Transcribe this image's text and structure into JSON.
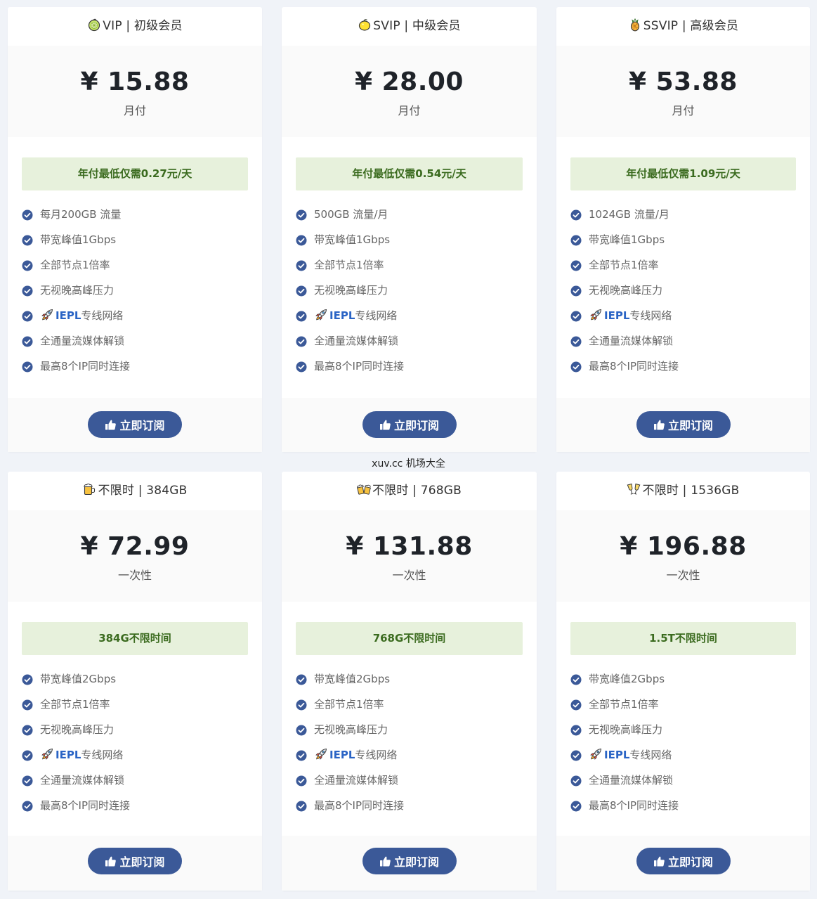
{
  "plans_row_1": [
    {
      "icon": "lime-icon",
      "title": "VIP | 初级会员",
      "price": "¥ 15.88",
      "period": "月付",
      "highlight": "年付最低仅需0.27元/天",
      "features": [
        "每月200GB 流量",
        "带宽峰值1Gbps",
        "全部节点1倍率",
        "无视晚高峰压力",
        "IEPL|专线网络",
        "全通量流媒体解锁",
        "最高8个IP同时连接"
      ],
      "button": "立即订阅"
    },
    {
      "icon": "lemon-icon",
      "title": "SVIP | 中级会员",
      "price": "¥ 28.00",
      "period": "月付",
      "highlight": "年付最低仅需0.54元/天",
      "features": [
        "500GB 流量/月",
        "带宽峰值1Gbps",
        "全部节点1倍率",
        "无视晚高峰压力",
        "IEPL|专线网络",
        "全通量流媒体解锁",
        "最高8个IP同时连接"
      ],
      "button": "立即订阅"
    },
    {
      "icon": "pineapple-icon",
      "title": "SSVIP | 高级会员",
      "price": "¥ 53.88",
      "period": "月付",
      "highlight": "年付最低仅需1.09元/天",
      "features": [
        "1024GB 流量/月",
        "带宽峰值1Gbps",
        "全部节点1倍率",
        "无视晚高峰压力",
        "IEPL|专线网络",
        "全通量流媒体解锁",
        "最高8个IP同时连接"
      ],
      "button": "立即订阅"
    }
  ],
  "watermark": "xuv.cc 机场大全",
  "plans_row_2": [
    {
      "icon": "beer-mug-icon",
      "title": "不限时 | 384GB",
      "price": "¥ 72.99",
      "period": "一次性",
      "highlight": "384G不限时间",
      "features": [
        "带宽峰值2Gbps",
        "全部节点1倍率",
        "无视晚高峰压力",
        "IEPL|专线网络",
        "全通量流媒体解锁",
        "最高8个IP同时连接"
      ],
      "button": "立即订阅"
    },
    {
      "icon": "clinking-beers-icon",
      "title": "不限时 | 768GB",
      "price": "¥ 131.88",
      "period": "一次性",
      "highlight": "768G不限时间",
      "features": [
        "带宽峰值2Gbps",
        "全部节点1倍率",
        "无视晚高峰压力",
        "IEPL|专线网络",
        "全通量流媒体解锁",
        "最高8个IP同时连接"
      ],
      "button": "立即订阅"
    },
    {
      "icon": "champagne-glasses-icon",
      "title": "不限时 | 1536GB",
      "price": "¥ 196.88",
      "period": "一次性",
      "highlight": "1.5T不限时间",
      "features": [
        "带宽峰值2Gbps",
        "全部节点1倍率",
        "无视晚高峰压力",
        "IEPL|专线网络",
        "全通量流媒体解锁",
        "最高8个IP同时连接"
      ],
      "button": "立即订阅"
    }
  ],
  "colors": {
    "accent": "#3b5998",
    "highlight_bg": "#e7f1dc",
    "highlight_text": "#3b6b1f",
    "iepl_text": "#2a64c5",
    "page_bg": "#f0f3f8"
  }
}
